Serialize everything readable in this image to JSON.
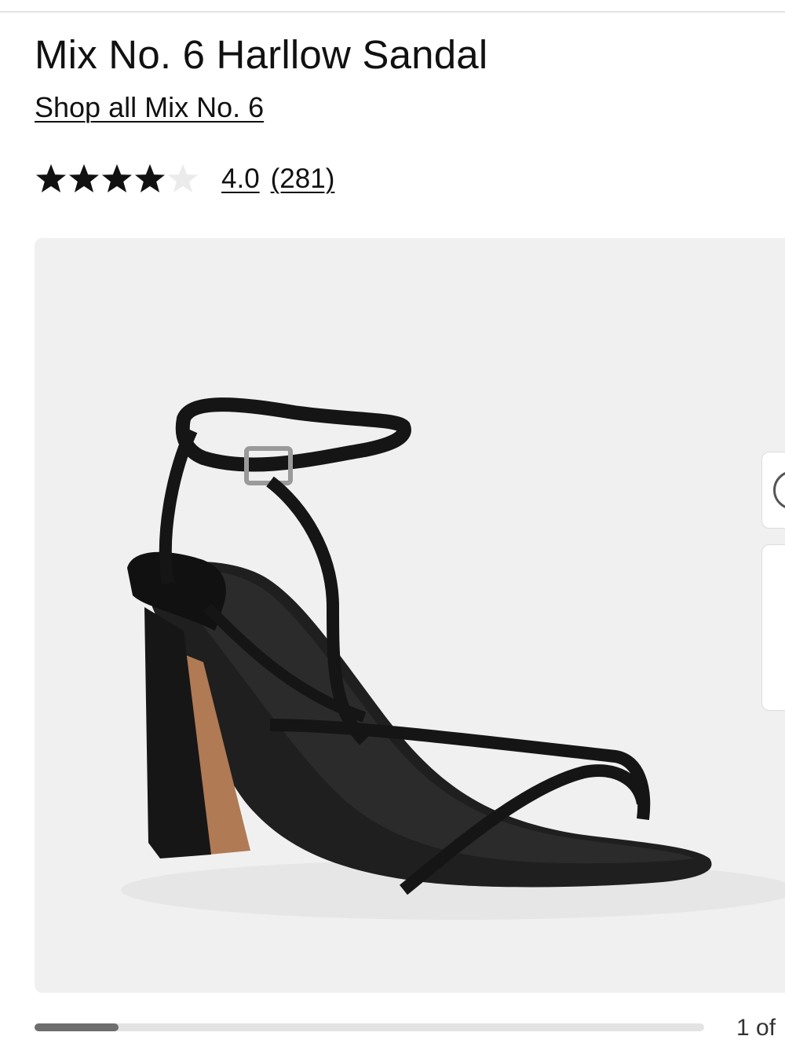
{
  "product": {
    "title": "Mix No. 6 Harllow Sandal",
    "brand_link": "Shop all Mix No. 6",
    "rating": {
      "value": "4.0",
      "count": "(281)",
      "stars_filled": 4,
      "stars_total": 5
    }
  },
  "gallery": {
    "image_alt": "Black strappy block heel sandal with ankle buckle strap",
    "carousel_position": 0.125,
    "page_indicator": "1 of"
  },
  "colors": {
    "text": "#111111",
    "image_background": "#f0f0f0",
    "star_filled": "#111111",
    "star_empty": "#ebebeb",
    "progress_track": "#e3e3e3",
    "progress_thumb": "#6e6e6e"
  }
}
